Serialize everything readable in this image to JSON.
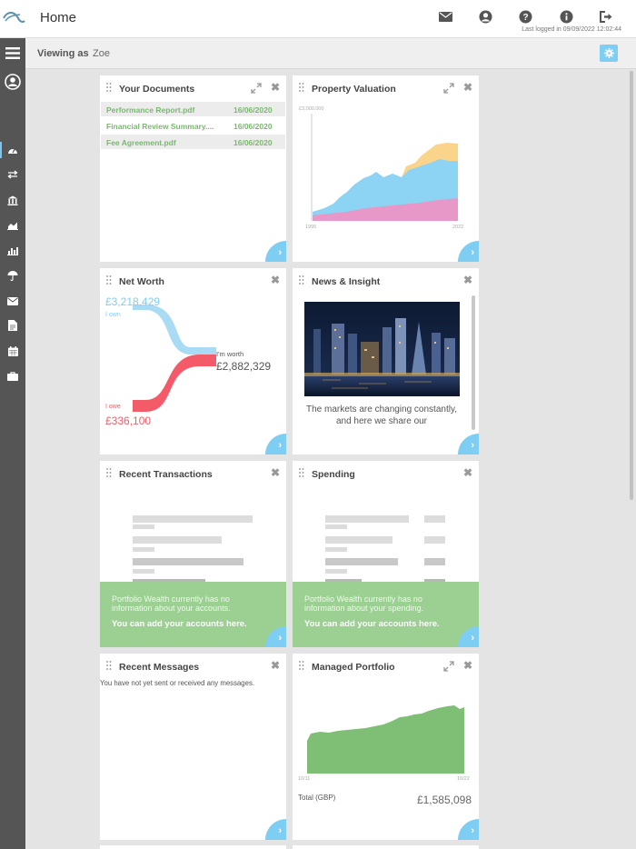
{
  "app": {
    "title": "Home",
    "last_logged": "Last logged in 09/09/2022 12:02:44"
  },
  "viewing": {
    "label": "Viewing as",
    "name": "Zoe"
  },
  "header_icons": [
    "envelope-icon",
    "user-icon",
    "help-icon",
    "info-icon",
    "logout-icon"
  ],
  "sidebar_icons": [
    "menu-icon",
    "profile-icon",
    "dashboard-icon",
    "transfer-icon",
    "bank-icon",
    "area-chart-icon",
    "bar-chart-icon",
    "umbrella-icon",
    "mail-icon",
    "document-icon",
    "calendar-icon",
    "briefcase-icon"
  ],
  "documents": {
    "title": "Your Documents",
    "items": [
      {
        "name": "Performance Report.pdf",
        "date": "16/06/2020"
      },
      {
        "name": "Financial Review Summary....",
        "date": "16/06/2020"
      },
      {
        "name": "Fee Agreement.pdf",
        "date": "16/06/2020"
      }
    ]
  },
  "property": {
    "title": "Property Valuation",
    "y_label": "£3,000,000",
    "x_start": "1995",
    "x_end": "2022"
  },
  "networth": {
    "title": "Net Worth",
    "own_amount": "£3,218,429",
    "own_label": "I own",
    "worth_label": "I'm worth",
    "worth_amount": "£2,882,329",
    "owe_label": "I owe",
    "owe_amount": "£336,100"
  },
  "news": {
    "title": "News & Insight",
    "text": "The markets are changing constantly, and here we share our"
  },
  "transactions": {
    "title": "Recent Transactions",
    "overlay_text": "Portfolio Wealth currently has no information about your accounts.",
    "overlay_link": "You can add your accounts here."
  },
  "spending": {
    "title": "Spending",
    "overlay_text": "Portfolio Wealth currently has no information about your spending.",
    "overlay_link": "You can add your accounts here."
  },
  "messages": {
    "title": "Recent Messages",
    "empty_text": "You have not yet sent or received any messages."
  },
  "portfolio": {
    "title": "Managed Portfolio",
    "x_start": "10/11",
    "x_end": "10/22",
    "total_label": "Total (GBP)",
    "total_value": "£1,585,098"
  },
  "colors": {
    "accent": "#7ecdf3",
    "green": "#7ab870",
    "red": "#f45b69",
    "sidebar": "#555555"
  }
}
